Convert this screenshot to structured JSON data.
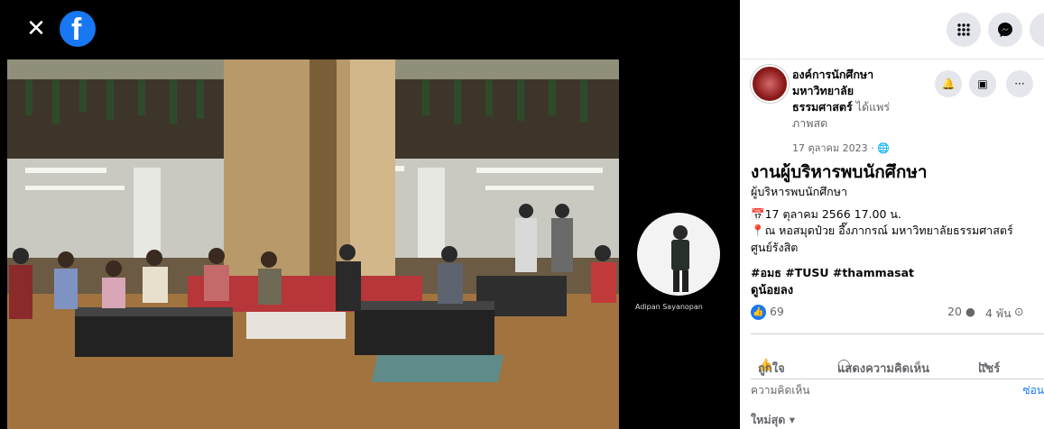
{
  "viewer": {
    "close_glyph": "✕",
    "logo_glyph": "f",
    "pip_name": "Adipan Sayanopan"
  },
  "panel": {
    "topbar_icons": [
      "grid-menu-icon",
      "messenger-icon",
      "notifications-icon"
    ],
    "page_name_line1": "องค์การนักศึกษา",
    "page_name_line2": "มหาวิทยาลัย",
    "page_name_line3": "ธรรมศาสตร์",
    "shared_text": " ได้แพร่",
    "shared_text2": "ภาพสด",
    "date": "17 ตุลาคม 2023 · ",
    "title": "งานผู้บริหารพบนักศึกษา",
    "subtitle": "ผู้บริหารพบนักศึกษา",
    "detail_date": "17 ตุลาคม 2566 17.00 น.",
    "detail_place": "ณ หอสมุดป๋วย อึ๊งภากรณ์ มหาวิทยาลัยธรรมศาสตร์",
    "detail_place2": "ศูนย์รังสิต",
    "tags": "#อมธ #TUSU #thammasat",
    "see_more": "ดูน้อยลง",
    "reactions_count": "69",
    "comments_count": "20",
    "views": "4 พัน",
    "like_label": "ถูกใจ",
    "comment_label": "แสดงความคิดเห็น",
    "share_label": "แชร์",
    "comments_heading": "ความคิดเห็น",
    "hide_label": "ซ่อน",
    "sort_label": "ใหม่สุด"
  },
  "colors": {
    "accent": "#1877f2",
    "bg_panel": "#ffffff",
    "muted": "#65676b"
  }
}
